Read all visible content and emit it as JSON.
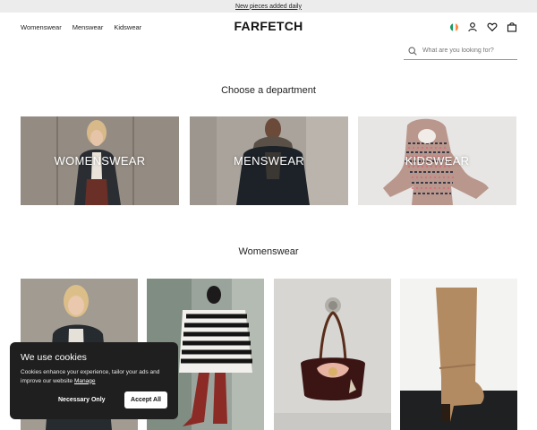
{
  "topbar": {
    "promo_link": "New pieces added daily"
  },
  "header": {
    "nav": [
      "Womenswear",
      "Menswear",
      "Kidswear"
    ],
    "logo": "FARFETCH",
    "icons": [
      "ireland-flag-icon",
      "account-icon",
      "wishlist-heart-icon",
      "shopping-bag-icon"
    ]
  },
  "search": {
    "placeholder": "What are you looking for?"
  },
  "departments": {
    "heading": "Choose a department",
    "items": [
      "WOMENSWEAR",
      "MENSWEAR",
      "KIDSWEAR"
    ]
  },
  "womenswear_section": {
    "heading": "Womenswear",
    "products": [
      "woman-in-black-coat-image",
      "striped-poncho-red-boots-image",
      "embroidered-handbag-image",
      "suede-knee-boot-image"
    ]
  },
  "cookie_banner": {
    "title": "We use cookies",
    "text": "Cookies enhance your experience, tailor your ads and improve our website",
    "manage_link": "Manage",
    "necessary_button": "Necessary Only",
    "accept_button": "Accept All"
  },
  "colors": {
    "topbar_bg": "#ececec",
    "cookie_bg": "#1f1f1f",
    "text": "#222222"
  }
}
